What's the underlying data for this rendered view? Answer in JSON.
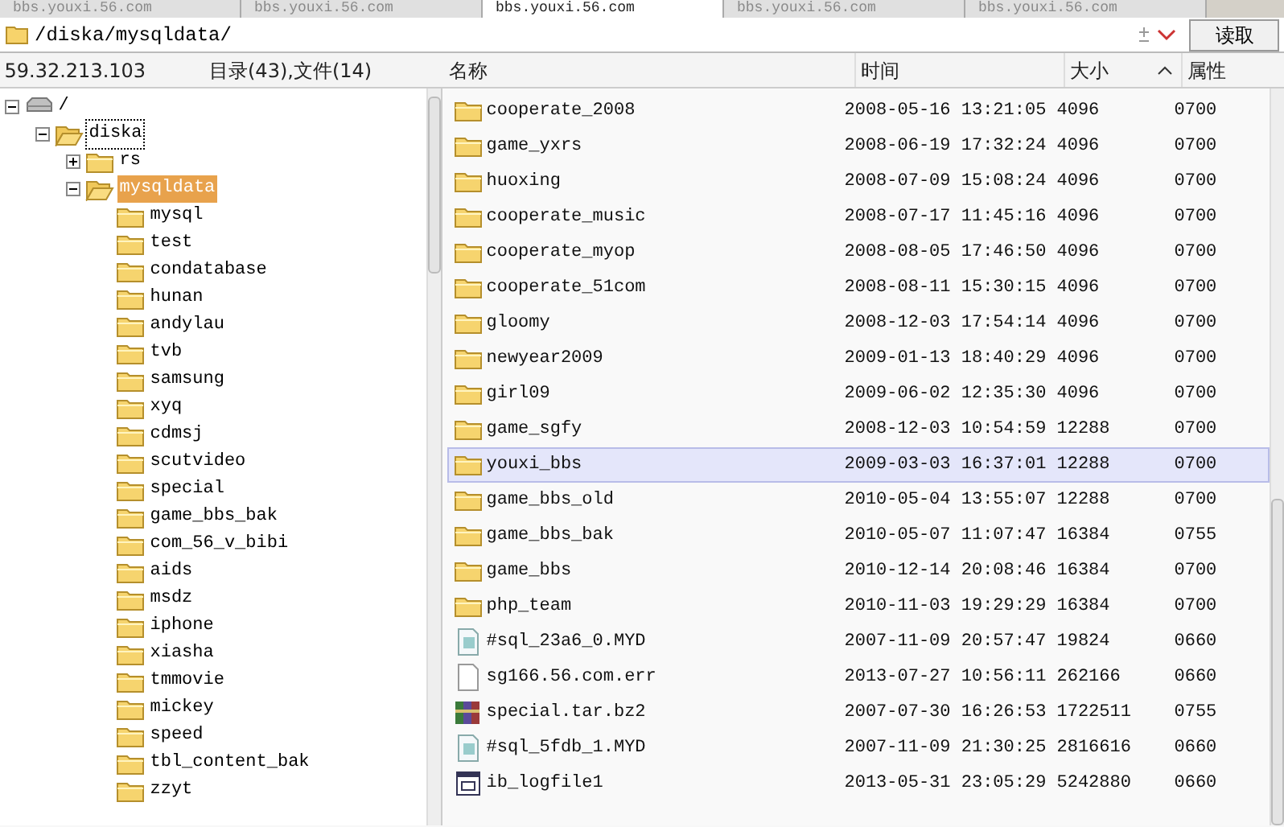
{
  "tabs": [
    {
      "label": "bbs.youxi.56.com",
      "selected": false
    },
    {
      "label": "bbs.youxi.56.com",
      "selected": false
    },
    {
      "label": "bbs.youxi.56.com",
      "selected": true
    },
    {
      "label": "bbs.youxi.56.com",
      "selected": false
    },
    {
      "label": "bbs.youxi.56.com",
      "selected": false
    }
  ],
  "address_bar": {
    "path": "/diska/mysqldata/",
    "read_button": "读取"
  },
  "status": {
    "host": "59.32.213.103",
    "counts": "目录(43),文件(14)"
  },
  "table": {
    "columns": [
      {
        "label": "名称",
        "sorted": false
      },
      {
        "label": "时间",
        "sorted": false
      },
      {
        "label": "大小",
        "sorted": true
      },
      {
        "label": "属性",
        "sorted": false
      }
    ],
    "rows": [
      {
        "kind": "folder",
        "name": "cooperate_2008",
        "time": "2008-05-16 13:21:05",
        "size": "4096",
        "attr": "0700",
        "selected": false
      },
      {
        "kind": "folder",
        "name": "game_yxrs",
        "time": "2008-06-19 17:32:24",
        "size": "4096",
        "attr": "0700",
        "selected": false
      },
      {
        "kind": "folder",
        "name": "huoxing",
        "time": "2008-07-09 15:08:24",
        "size": "4096",
        "attr": "0700",
        "selected": false
      },
      {
        "kind": "folder",
        "name": "cooperate_music",
        "time": "2008-07-17 11:45:16",
        "size": "4096",
        "attr": "0700",
        "selected": false
      },
      {
        "kind": "folder",
        "name": "cooperate_myop",
        "time": "2008-08-05 17:46:50",
        "size": "4096",
        "attr": "0700",
        "selected": false
      },
      {
        "kind": "folder",
        "name": "cooperate_51com",
        "time": "2008-08-11 15:30:15",
        "size": "4096",
        "attr": "0700",
        "selected": false
      },
      {
        "kind": "folder",
        "name": "gloomy",
        "time": "2008-12-03 17:54:14",
        "size": "4096",
        "attr": "0700",
        "selected": false
      },
      {
        "kind": "folder",
        "name": "newyear2009",
        "time": "2009-01-13 18:40:29",
        "size": "4096",
        "attr": "0700",
        "selected": false
      },
      {
        "kind": "folder",
        "name": "girl09",
        "time": "2009-06-02 12:35:30",
        "size": "4096",
        "attr": "0700",
        "selected": false
      },
      {
        "kind": "folder",
        "name": "game_sgfy",
        "time": "2008-12-03 10:54:59",
        "size": "12288",
        "attr": "0700",
        "selected": false
      },
      {
        "kind": "folder",
        "name": "youxi_bbs",
        "time": "2009-03-03 16:37:01",
        "size": "12288",
        "attr": "0700",
        "selected": true
      },
      {
        "kind": "folder",
        "name": "game_bbs_old",
        "time": "2010-05-04 13:55:07",
        "size": "12288",
        "attr": "0700",
        "selected": false
      },
      {
        "kind": "folder",
        "name": "game_bbs_bak",
        "time": "2010-05-07 11:07:47",
        "size": "16384",
        "attr": "0755",
        "selected": false
      },
      {
        "kind": "folder",
        "name": "game_bbs",
        "time": "2010-12-14 20:08:46",
        "size": "16384",
        "attr": "0700",
        "selected": false
      },
      {
        "kind": "folder",
        "name": "php_team",
        "time": "2010-11-03 19:29:29",
        "size": "16384",
        "attr": "0700",
        "selected": false
      },
      {
        "kind": "data",
        "name": "#sql_23a6_0.MYD",
        "time": "2007-11-09 20:57:47",
        "size": "19824",
        "attr": "0660",
        "selected": false
      },
      {
        "kind": "file",
        "name": "sg166.56.com.err",
        "time": "2013-07-27 10:56:11",
        "size": "262166",
        "attr": "0660",
        "selected": false
      },
      {
        "kind": "archive",
        "name": "special.tar.bz2",
        "time": "2007-07-30 16:26:53",
        "size": "1722511",
        "attr": "0755",
        "selected": false
      },
      {
        "kind": "data",
        "name": "#sql_5fdb_1.MYD",
        "time": "2007-11-09 21:30:25",
        "size": "2816616",
        "attr": "0660",
        "selected": false
      },
      {
        "kind": "log",
        "name": "ib_logfile1",
        "time": "2013-05-31 23:05:29",
        "size": "5242880",
        "attr": "0660",
        "selected": false
      }
    ]
  },
  "tree": [
    {
      "kind": "drive",
      "label": "/",
      "expanded": true,
      "selected": false,
      "focused": false,
      "children": [
        {
          "kind": "folder",
          "label": "diska",
          "expanded": true,
          "selected": false,
          "focused": true,
          "children": [
            {
              "kind": "folder",
              "label": "rs",
              "expanded": false,
              "selected": false,
              "focused": false
            },
            {
              "kind": "folder",
              "label": "mysqldata",
              "expanded": true,
              "selected": true,
              "focused": false,
              "children": [
                {
                  "kind": "folder",
                  "label": "mysql"
                },
                {
                  "kind": "folder",
                  "label": "test"
                },
                {
                  "kind": "folder",
                  "label": "condatabase"
                },
                {
                  "kind": "folder",
                  "label": "hunan"
                },
                {
                  "kind": "folder",
                  "label": "andylau"
                },
                {
                  "kind": "folder",
                  "label": "tvb"
                },
                {
                  "kind": "folder",
                  "label": "samsung"
                },
                {
                  "kind": "folder",
                  "label": "xyq"
                },
                {
                  "kind": "folder",
                  "label": "cdmsj"
                },
                {
                  "kind": "folder",
                  "label": "scutvideo"
                },
                {
                  "kind": "folder",
                  "label": "special"
                },
                {
                  "kind": "folder",
                  "label": "game_bbs_bak"
                },
                {
                  "kind": "folder",
                  "label": "com_56_v_bibi"
                },
                {
                  "kind": "folder",
                  "label": "aids"
                },
                {
                  "kind": "folder",
                  "label": "msdz"
                },
                {
                  "kind": "folder",
                  "label": "iphone"
                },
                {
                  "kind": "folder",
                  "label": "xiasha"
                },
                {
                  "kind": "folder",
                  "label": "tmmovie"
                },
                {
                  "kind": "folder",
                  "label": "mickey"
                },
                {
                  "kind": "folder",
                  "label": "speed"
                },
                {
                  "kind": "folder",
                  "label": "tbl_content_bak"
                },
                {
                  "kind": "folder",
                  "label": "zzyt"
                }
              ]
            }
          ]
        }
      ]
    }
  ]
}
